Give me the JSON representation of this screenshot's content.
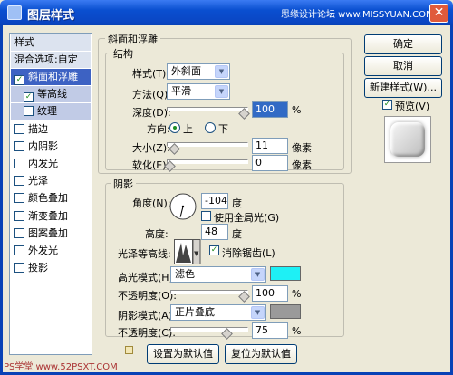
{
  "window": {
    "title": "图层样式",
    "watermark": "思缘设计论坛 www.MISSYUAN.COM",
    "close": "✕"
  },
  "left": {
    "styles": "样式",
    "blend_options": "混合选项:自定",
    "items": [
      {
        "label": "斜面和浮雕",
        "checked": true,
        "state": "selected"
      },
      {
        "label": "等高线",
        "checked": true,
        "state": "sub"
      },
      {
        "label": "纹理",
        "checked": false,
        "state": "sub"
      },
      {
        "label": "描边",
        "checked": false
      },
      {
        "label": "内阴影",
        "checked": false
      },
      {
        "label": "内发光",
        "checked": false
      },
      {
        "label": "光泽",
        "checked": false
      },
      {
        "label": "颜色叠加",
        "checked": false
      },
      {
        "label": "渐变叠加",
        "checked": false
      },
      {
        "label": "图案叠加",
        "checked": false
      },
      {
        "label": "外发光",
        "checked": false
      },
      {
        "label": "投影",
        "checked": false
      }
    ],
    "check_mark": "✓"
  },
  "bevel": {
    "title": "斜面和浮雕",
    "structure": "结构",
    "style_label": "样式(T):",
    "style_value": "外斜面",
    "technique_label": "方法(Q):",
    "technique_value": "平滑",
    "depth_label": "深度(D):",
    "depth_value": "100",
    "depth_unit": "%",
    "depth_level": 1.0,
    "direction_label": "方向:",
    "dir_up": "上",
    "dir_down": "下",
    "size_label": "大小(Z):",
    "size_value": "11",
    "size_unit": "像素",
    "size_level": 0.06,
    "soften_label": "软化(E):",
    "soften_value": "0",
    "soften_unit": "像素",
    "soften_level": 0.0
  },
  "shading": {
    "title": "阴影",
    "angle_label": "角度(N):",
    "angle_value": "-104",
    "angle_unit": "度",
    "global_light": "使用全局光(G)",
    "altitude_label": "高度:",
    "altitude_value": "48",
    "altitude_unit": "度",
    "gloss_label": "光泽等高线:",
    "anti_alias": "消除锯齿(L)",
    "highlight_label": "高光模式(H):",
    "highlight_mode": "滤色",
    "highlight_color": "#1ef0f5",
    "hl_opacity_label": "不透明度(O):",
    "hl_opacity_value": "100",
    "hl_opacity_level": 1.0,
    "shadow_label": "阴影模式(A):",
    "shadow_mode": "正片叠底",
    "shadow_color": "#9a9a9a",
    "sh_opacity_label": "不透明度(C):",
    "sh_opacity_value": "75",
    "sh_opacity_level": 0.75,
    "percent": "%"
  },
  "footer": {
    "make_default": "设置为默认值",
    "reset_default": "复位为默认值",
    "watermark": "PS学堂 www.52PSXT.COM"
  },
  "buttons": {
    "ok": "确定",
    "cancel": "取消",
    "new_style": "新建样式(W)...",
    "preview": "预览(V)"
  }
}
